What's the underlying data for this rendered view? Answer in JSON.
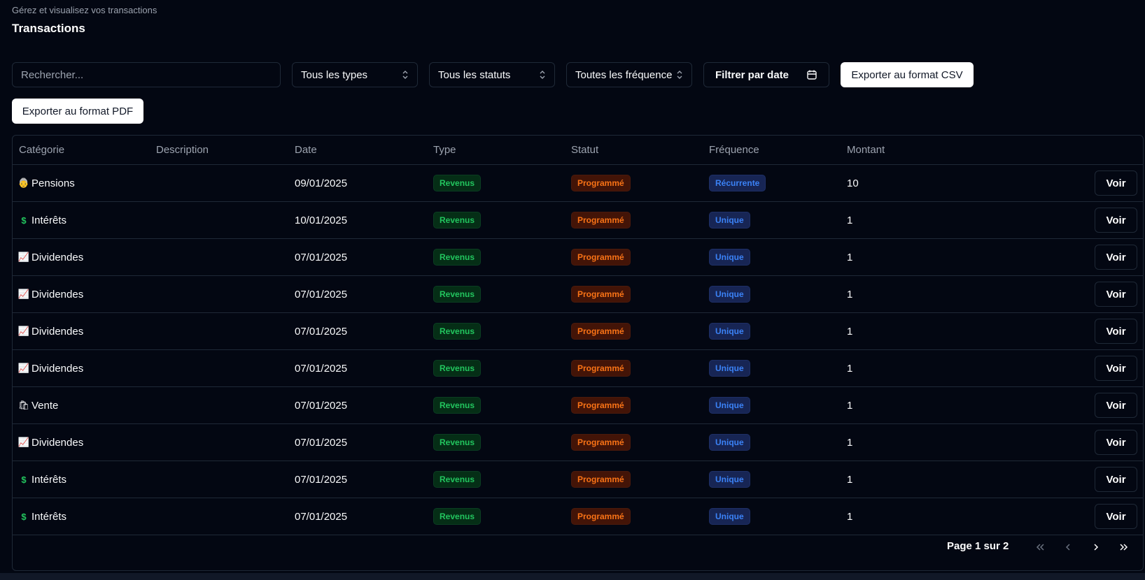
{
  "header": {
    "subtitle": "Gérez et visualisez vos transactions",
    "title": "Transactions"
  },
  "filters": {
    "search_placeholder": "Rechercher...",
    "types": "Tous les types",
    "status": "Tous les statuts",
    "frequency": "Toutes les fréquence",
    "date": "Filtrer par date",
    "export_csv": "Exporter au format CSV",
    "export_pdf": "Exporter au format PDF"
  },
  "table": {
    "columns": [
      "Catégorie",
      "Description",
      "Date",
      "Type",
      "Statut",
      "Fréquence",
      "Montant"
    ],
    "rows": [
      {
        "icon": "👵",
        "category": "Pensions",
        "description": "",
        "date": "09/01/2025",
        "type": "Revenus",
        "status": "Programmé",
        "frequency": "Récurrente",
        "amount": "10",
        "action": "Voir"
      },
      {
        "icon": "$",
        "category": "Intérêts",
        "description": "",
        "date": "10/01/2025",
        "type": "Revenus",
        "status": "Programmé",
        "frequency": "Unique",
        "amount": "1",
        "action": "Voir"
      },
      {
        "icon": "📈",
        "category": "Dividendes",
        "description": "",
        "date": "07/01/2025",
        "type": "Revenus",
        "status": "Programmé",
        "frequency": "Unique",
        "amount": "1",
        "action": "Voir"
      },
      {
        "icon": "📈",
        "category": "Dividendes",
        "description": "",
        "date": "07/01/2025",
        "type": "Revenus",
        "status": "Programmé",
        "frequency": "Unique",
        "amount": "1",
        "action": "Voir"
      },
      {
        "icon": "📈",
        "category": "Dividendes",
        "description": "",
        "date": "07/01/2025",
        "type": "Revenus",
        "status": "Programmé",
        "frequency": "Unique",
        "amount": "1",
        "action": "Voir"
      },
      {
        "icon": "📈",
        "category": "Dividendes",
        "description": "",
        "date": "07/01/2025",
        "type": "Revenus",
        "status": "Programmé",
        "frequency": "Unique",
        "amount": "1",
        "action": "Voir"
      },
      {
        "icon": "🛍",
        "category": "Vente",
        "description": "",
        "date": "07/01/2025",
        "type": "Revenus",
        "status": "Programmé",
        "frequency": "Unique",
        "amount": "1",
        "action": "Voir"
      },
      {
        "icon": "📈",
        "category": "Dividendes",
        "description": "",
        "date": "07/01/2025",
        "type": "Revenus",
        "status": "Programmé",
        "frequency": "Unique",
        "amount": "1",
        "action": "Voir"
      },
      {
        "icon": "$",
        "category": "Intérêts",
        "description": "",
        "date": "07/01/2025",
        "type": "Revenus",
        "status": "Programmé",
        "frequency": "Unique",
        "amount": "1",
        "action": "Voir"
      },
      {
        "icon": "$",
        "category": "Intérêts",
        "description": "",
        "date": "07/01/2025",
        "type": "Revenus",
        "status": "Programmé",
        "frequency": "Unique",
        "amount": "1",
        "action": "Voir"
      }
    ]
  },
  "pagination": {
    "label": "Page 1 sur 2"
  },
  "colors": {
    "background": "#030712",
    "revenue": "#22c55e",
    "scheduled": "#f97316",
    "frequency": "#3b82f6"
  }
}
